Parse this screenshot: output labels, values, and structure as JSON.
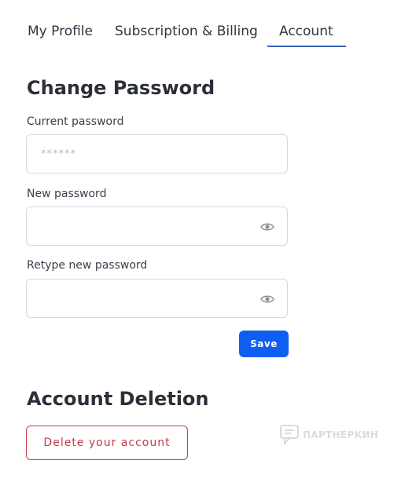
{
  "tabs": {
    "items": [
      {
        "label": "My Profile"
      },
      {
        "label": "Subscription & Billing"
      },
      {
        "label": "Account"
      }
    ],
    "active": "Account"
  },
  "password_section": {
    "title": "Change Password",
    "current": {
      "label": "Current password",
      "placeholder": "******"
    },
    "new": {
      "label": "New password",
      "value": "",
      "toggle_icon": "eye-icon"
    },
    "retype": {
      "label": "Retype new password",
      "value": "",
      "toggle_icon": "eye-icon"
    },
    "save_label": "Save"
  },
  "deletion_section": {
    "title": "Account Deletion",
    "delete_label": "Delete your account"
  },
  "watermark": {
    "icon": "chat-bubble-logo",
    "text": "ПАРТНЕРКИН"
  },
  "colors": {
    "accent": "#0e5ef1",
    "tab_underline": "#3a66b7",
    "danger": "#c23a4a",
    "border": "#d5d8de",
    "text": "#2b2f38"
  }
}
